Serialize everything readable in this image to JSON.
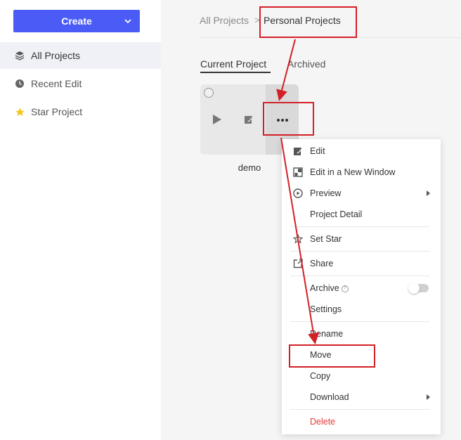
{
  "sidebar": {
    "create_label": "Create",
    "items": [
      {
        "label": "All Projects",
        "icon": "layers-icon"
      },
      {
        "label": "Recent Edit",
        "icon": "clock-icon"
      },
      {
        "label": "Star Project",
        "icon": "star-icon"
      }
    ]
  },
  "breadcrumb": {
    "root": "All Projects",
    "separator": ">",
    "current": "Personal Projects"
  },
  "tabs": [
    {
      "label": "Current Project",
      "active": true
    },
    {
      "label": "Archived",
      "active": false
    }
  ],
  "project": {
    "name": "demo"
  },
  "menu": {
    "items": [
      {
        "label": "Edit",
        "icon": "edit-icon"
      },
      {
        "label": "Edit in a New Window",
        "icon": "new-window-icon"
      },
      {
        "label": "Preview",
        "icon": "play-circle-icon",
        "submenu": true
      },
      {
        "label": "Project Detail"
      },
      {
        "label": "Set Star",
        "icon": "star-outline-icon"
      },
      {
        "label": "Share",
        "icon": "share-icon"
      },
      {
        "label": "Archive",
        "toggle": false,
        "help": "?"
      },
      {
        "label": "Settings"
      },
      {
        "label": "Rename"
      },
      {
        "label": "Move"
      },
      {
        "label": "Copy"
      },
      {
        "label": "Download",
        "submenu": true
      },
      {
        "label": "Delete",
        "danger": true
      }
    ]
  },
  "colors": {
    "accent": "#4a5cf5",
    "annotation": "#d32027",
    "danger": "#e53935"
  }
}
